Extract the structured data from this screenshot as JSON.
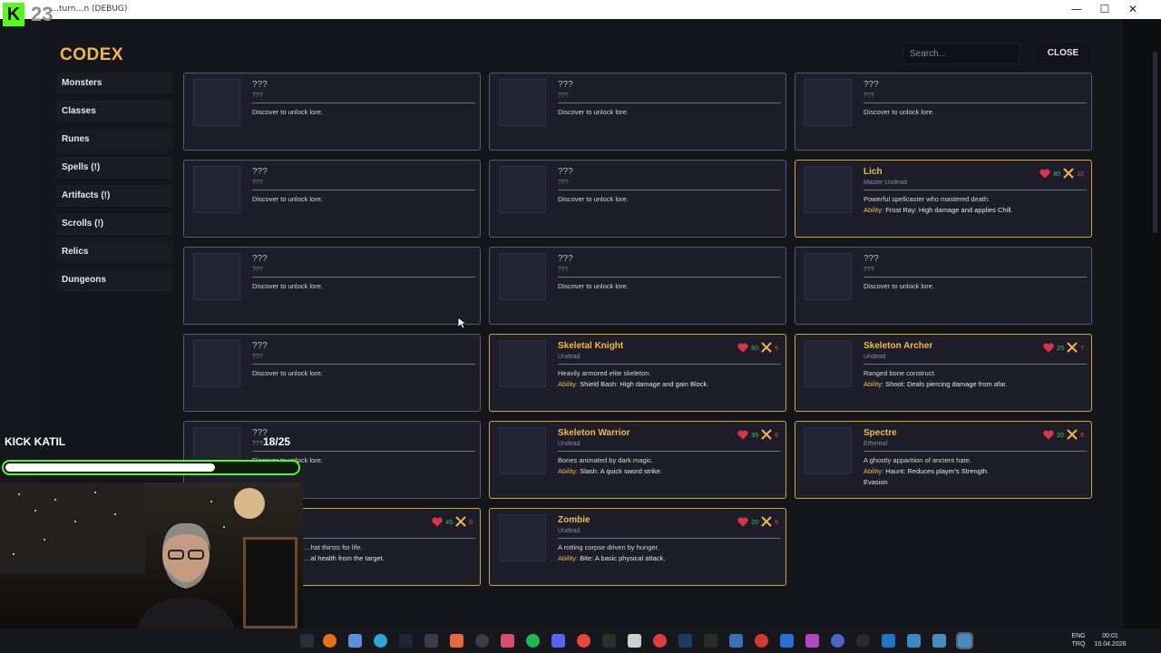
{
  "window": {
    "title": "…turn…n (DEBUG)",
    "minimize": "—",
    "maximize": "☐",
    "close": "✕"
  },
  "overlay_logo": {
    "letter": "K",
    "number": "23"
  },
  "codex": {
    "title": "CODEX",
    "search_placeholder": "Search...",
    "close_label": "CLOSE",
    "categories": [
      "Monsters",
      "Classes",
      "Runes",
      "Spells (!)",
      "Artifacts (!)",
      "Scrolls (!)",
      "Relics",
      "Dungeons"
    ],
    "locked": {
      "name": "???",
      "sub": "???",
      "desc": "Discover to unlock lore."
    },
    "ability_label": "Ability:",
    "cards": {
      "lich": {
        "name": "Lich",
        "type": "Master Undead",
        "hp": "80",
        "atk": "10",
        "desc": "Powerful spellcaster who mastered death.",
        "ability": "Frost Ray: High damage and applies Chill."
      },
      "skeletal_knight": {
        "name": "Skeletal Knight",
        "type": "Undead",
        "hp": "60",
        "atk": "5",
        "desc": "Heavily armored elite skeleton.",
        "ability": "Shield Bash: High damage and gain Block."
      },
      "skeleton_archer": {
        "name": "Skeleton Archer",
        "type": "Undead",
        "hp": "25",
        "atk": "7",
        "desc": "Ranged bone construct.",
        "ability": "Shoot: Deals piercing damage from afar."
      },
      "skeleton_warrior": {
        "name": "Skeleton Warrior",
        "type": "Undead",
        "hp": "35",
        "atk": "6",
        "desc": "Bones animated by dark magic.",
        "ability": "Slash: A quick sword strike."
      },
      "spectre": {
        "name": "Spectre",
        "type": "Ethereal",
        "hp": "20",
        "atk": "6",
        "desc": "A ghostly apparition of ancient hate.",
        "ability": "Haunt: Reduces player's Strength.",
        "extra": "Evasion"
      },
      "vampire_partial": {
        "hp": "45",
        "atk": "8",
        "desc": "…hat thirsts for life.",
        "ability": "…al health from the target."
      },
      "zombie": {
        "name": "Zombie",
        "type": "Undead",
        "hp": "20",
        "atk": "5",
        "desc": "A rotting corpse driven by hunger.",
        "ability": "Bite: A basic physical attack."
      }
    }
  },
  "stream_overlay": {
    "goal_label": "KICK KATIL",
    "current": "18",
    "separator": "/",
    "target": "25",
    "progress": 0.72
  },
  "taskbar": {
    "lang": "ENG",
    "layout": "TRQ",
    "time": "00:01",
    "date": "10.04.2026"
  },
  "colors": {
    "accent": "#f0b94a",
    "kick_green": "#53fc18",
    "hp": "#4fbf58",
    "atk": "#d9503a"
  }
}
